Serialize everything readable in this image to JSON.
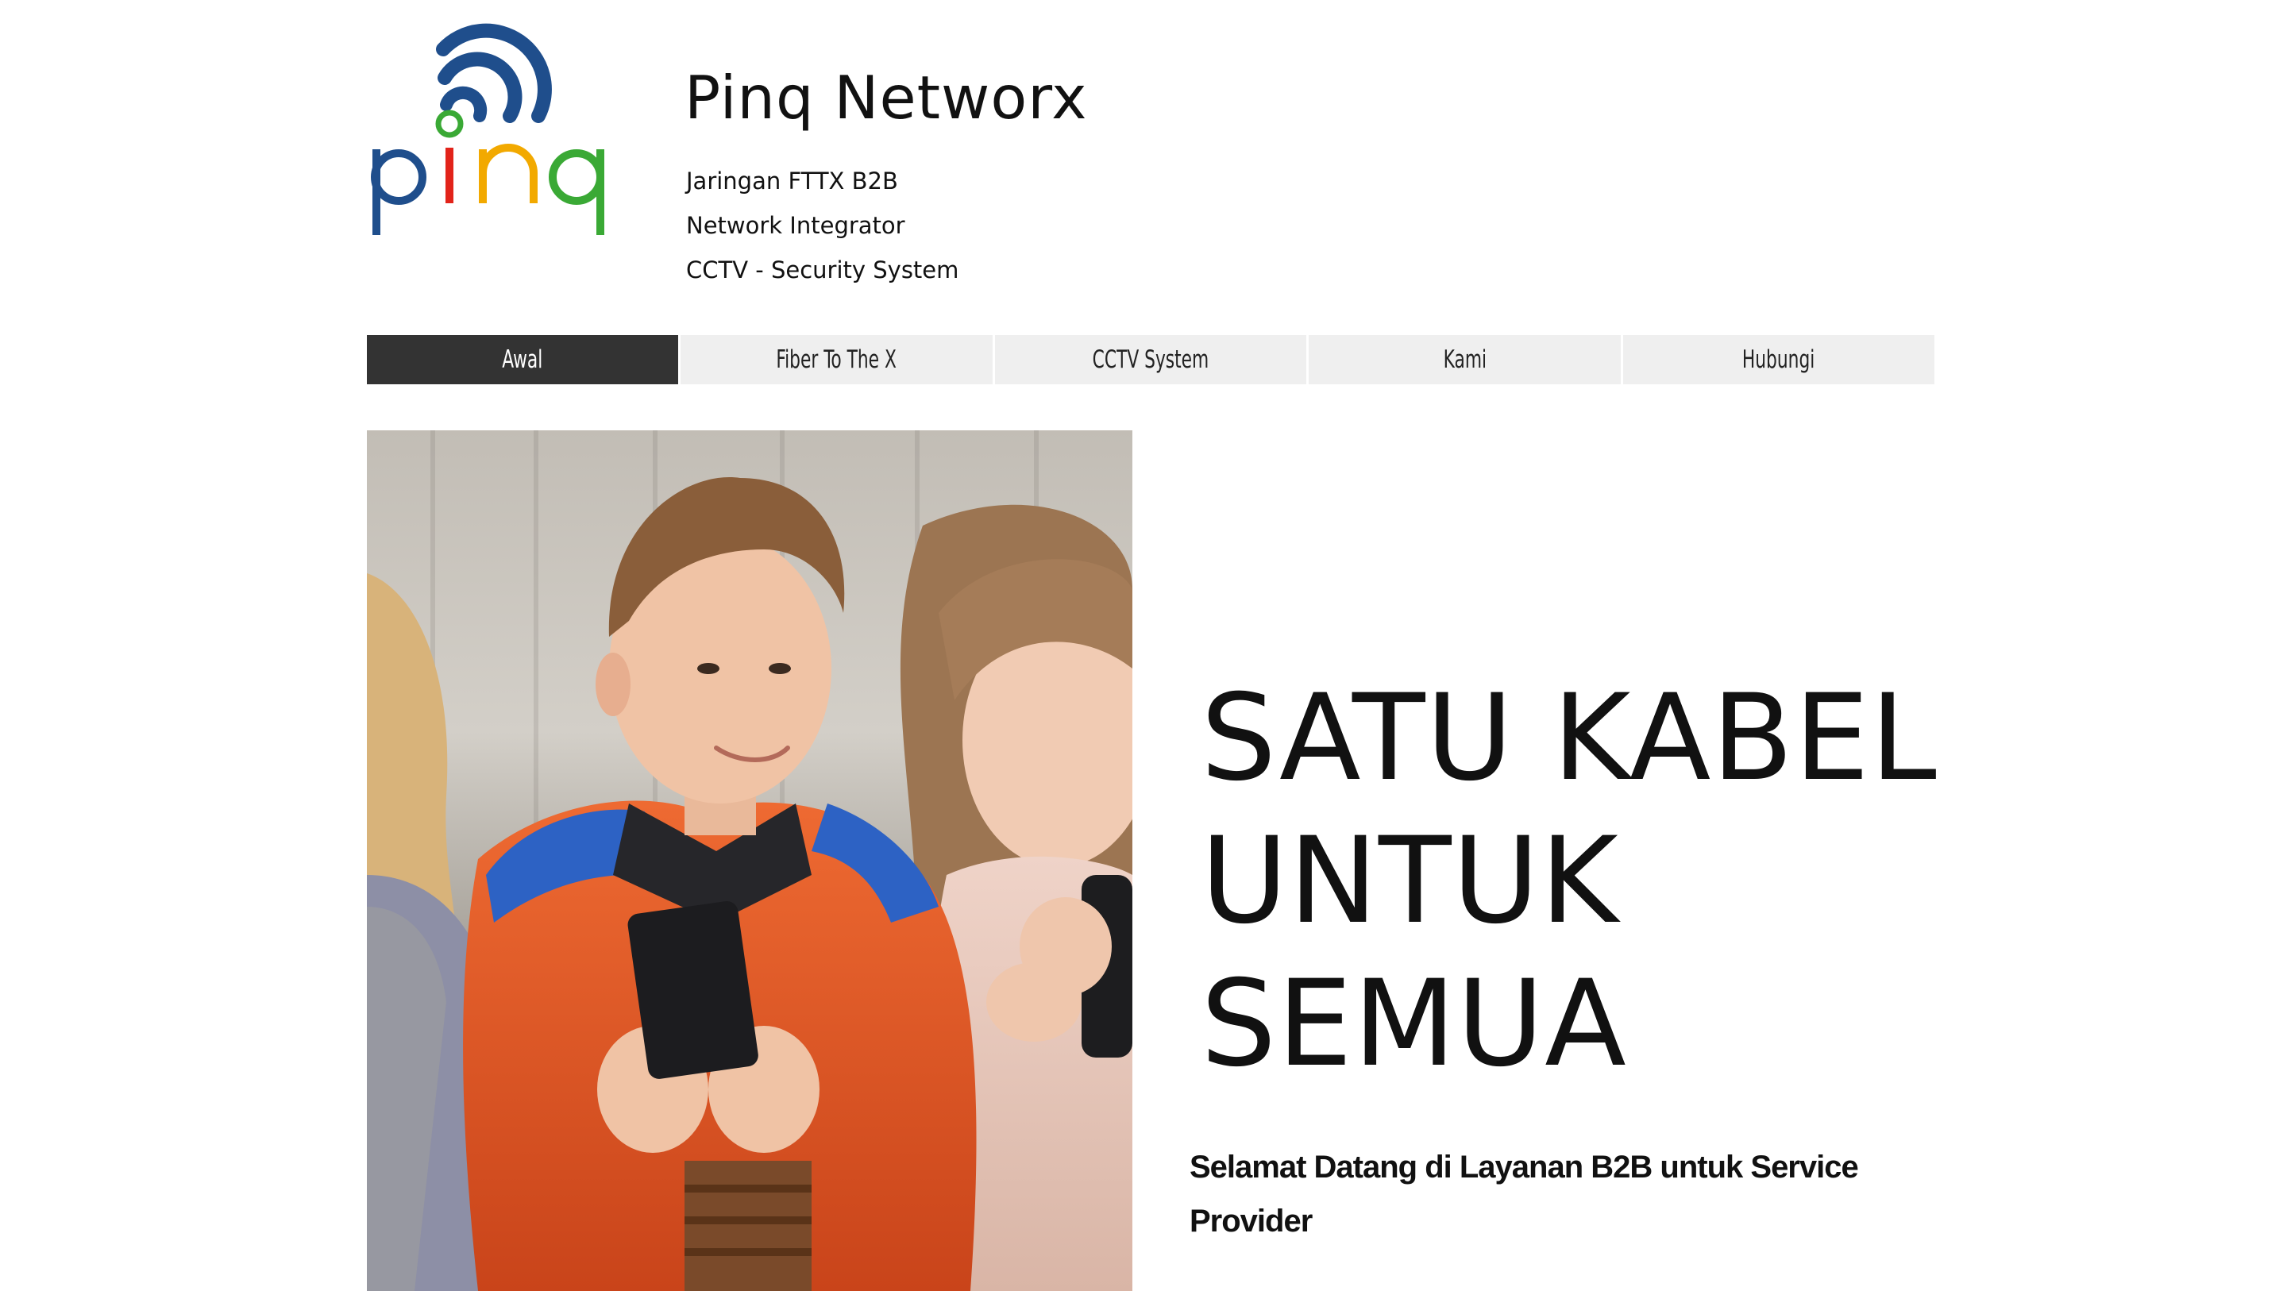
{
  "header": {
    "site_title": "Pinq Networx",
    "taglines": [
      "Jaringan FTTX B2B",
      "Network Integrator",
      "CCTV - Security System"
    ],
    "logo_text": "pinq",
    "logo_colors": {
      "p": "#1f4e8c",
      "i": "#e2231a",
      "n": "#f2a900",
      "q": "#3aa935",
      "wifi": "#1f4e8c",
      "dot": "#3aa935"
    }
  },
  "nav": {
    "items": [
      {
        "label": "Awal",
        "active": true
      },
      {
        "label": "Fiber To The X",
        "active": false
      },
      {
        "label": "CCTV System",
        "active": false
      },
      {
        "label": "Kami",
        "active": false
      },
      {
        "label": "Hubungi",
        "active": false
      }
    ]
  },
  "hero": {
    "headline_lines": [
      "SATU KABEL",
      "UNTUK",
      "SEMUA"
    ],
    "welcome_text": "Selamat Datang di Layanan B2B untuk Service Provider",
    "image_icon": "children-with-smartphones-photo"
  }
}
